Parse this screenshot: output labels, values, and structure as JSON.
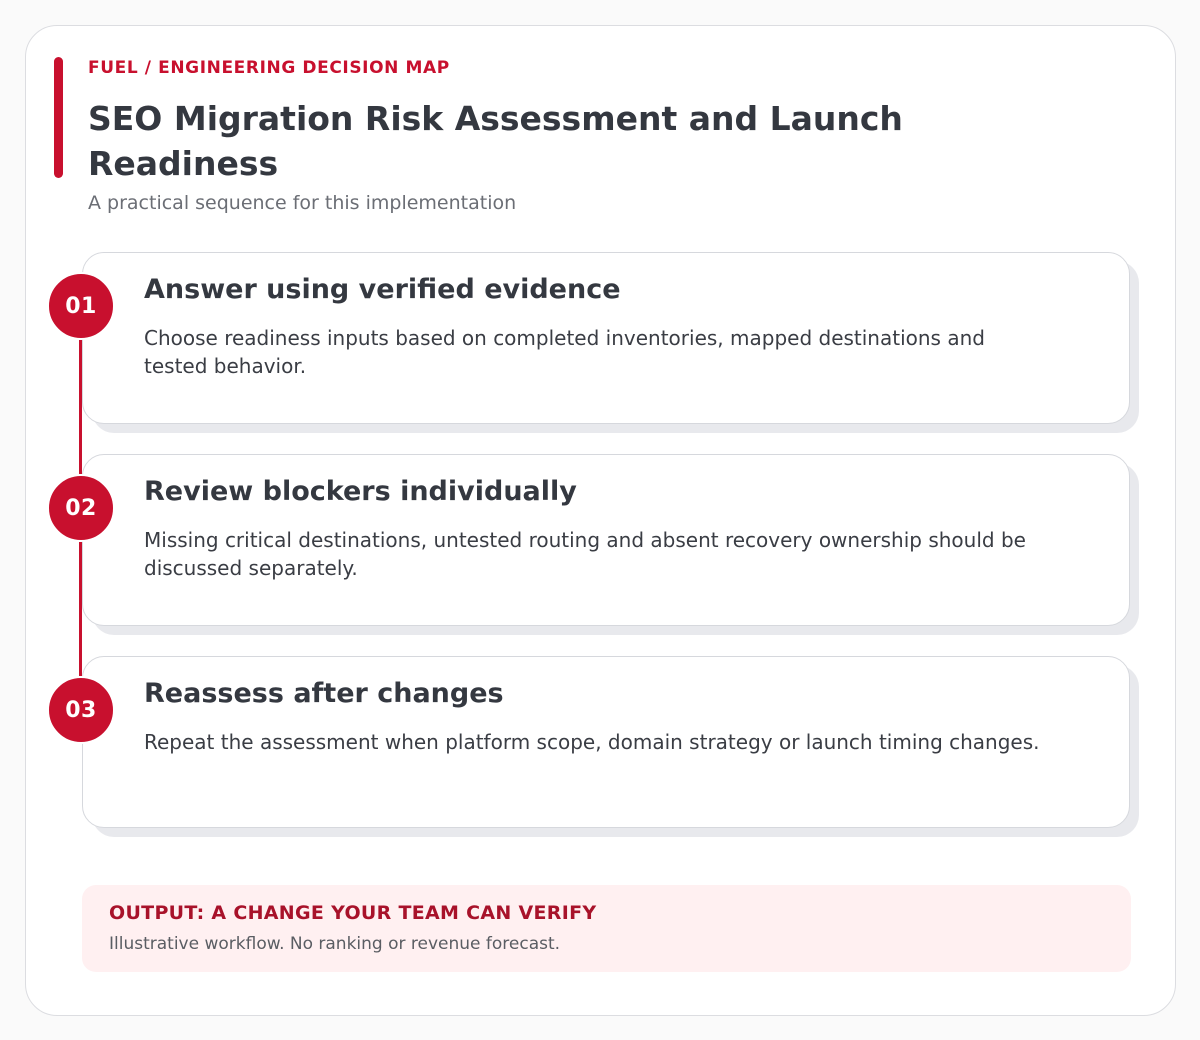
{
  "header": {
    "eyebrow": "FUEL / ENGINEERING DECISION MAP",
    "title": "SEO Migration Risk Assessment and Launch Readiness",
    "subtitle": "A practical sequence for this implementation"
  },
  "steps": [
    {
      "number": "01",
      "title": "Answer using verified evidence",
      "description": "Choose readiness inputs based on completed inventories, mapped destinations and tested behavior."
    },
    {
      "number": "02",
      "title": "Review blockers individually",
      "description": "Missing critical destinations, untested routing and absent recovery ownership should be discussed separately."
    },
    {
      "number": "03",
      "title": "Reassess after changes",
      "description": "Repeat the assessment when platform scope, domain strategy or launch timing changes."
    }
  ],
  "output": {
    "title": "OUTPUT: A CHANGE YOUR TEAM CAN VERIFY",
    "note": "Illustrative workflow. No ranking or revenue forecast."
  },
  "colors": {
    "accent": "#c8102e",
    "output_background": "#fff0f1",
    "text": "#343840"
  }
}
